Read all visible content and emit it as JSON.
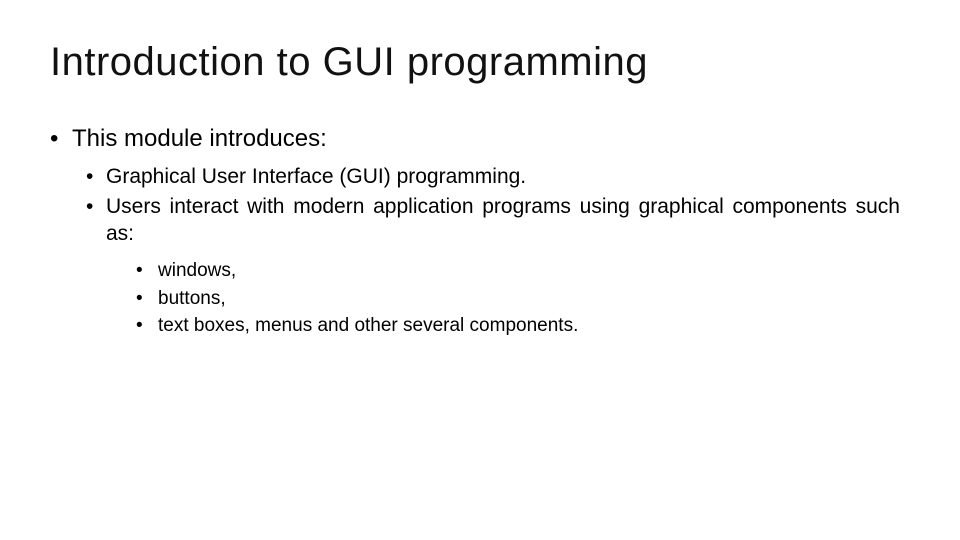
{
  "title": "Introduction to GUI programming",
  "bullets": {
    "level1": {
      "item1": "This module introduces:"
    },
    "level2": {
      "item1": "Graphical User Interface (GUI) programming.",
      "item2": "Users interact with modern application programs using graphical components such as:"
    },
    "level3": {
      "item1": "windows,",
      "item2": "buttons,",
      "item3": "text boxes, menus and other several components."
    }
  }
}
